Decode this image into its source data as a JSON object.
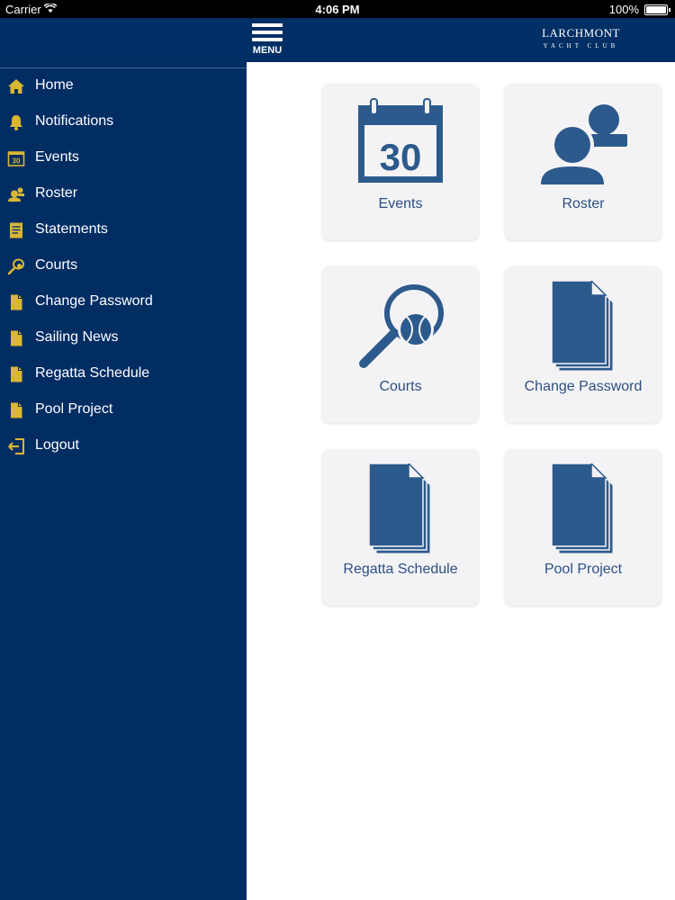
{
  "status_bar": {
    "carrier": "Carrier",
    "time": "4:06 PM",
    "battery": "100%"
  },
  "header": {
    "menu_label": "MENU",
    "logo_line1": "LARCHMONT",
    "logo_line2": "YACHT CLUB"
  },
  "colors": {
    "header_bg": "#002f65",
    "sidebar_bg": "#022d63",
    "icon_gold": "#d9b733",
    "tile_icon": "#2d5a8c",
    "tile_bg": "#f3f3f5"
  },
  "sidebar": {
    "items": [
      {
        "label": "Home",
        "icon": "home-icon"
      },
      {
        "label": "Notifications",
        "icon": "bell-icon"
      },
      {
        "label": "Events",
        "icon": "calendar-icon"
      },
      {
        "label": "Roster",
        "icon": "people-icon"
      },
      {
        "label": "Statements",
        "icon": "statement-icon"
      },
      {
        "label": "Courts",
        "icon": "racket-icon"
      },
      {
        "label": "Change Password",
        "icon": "document-icon"
      },
      {
        "label": "Sailing News",
        "icon": "document-icon"
      },
      {
        "label": "Regatta Schedule",
        "icon": "document-icon"
      },
      {
        "label": "Pool Project",
        "icon": "document-icon"
      },
      {
        "label": "Logout",
        "icon": "logout-icon"
      }
    ]
  },
  "tiles": [
    {
      "label": "Events",
      "icon": "calendar-icon",
      "calendar_day": "30"
    },
    {
      "label": "Roster",
      "icon": "people-icon"
    },
    {
      "label": "Courts",
      "icon": "racket-icon"
    },
    {
      "label": "Change Password",
      "icon": "document-icon"
    },
    {
      "label": "Regatta Schedule",
      "icon": "document-icon"
    },
    {
      "label": "Pool Project",
      "icon": "document-icon"
    }
  ]
}
